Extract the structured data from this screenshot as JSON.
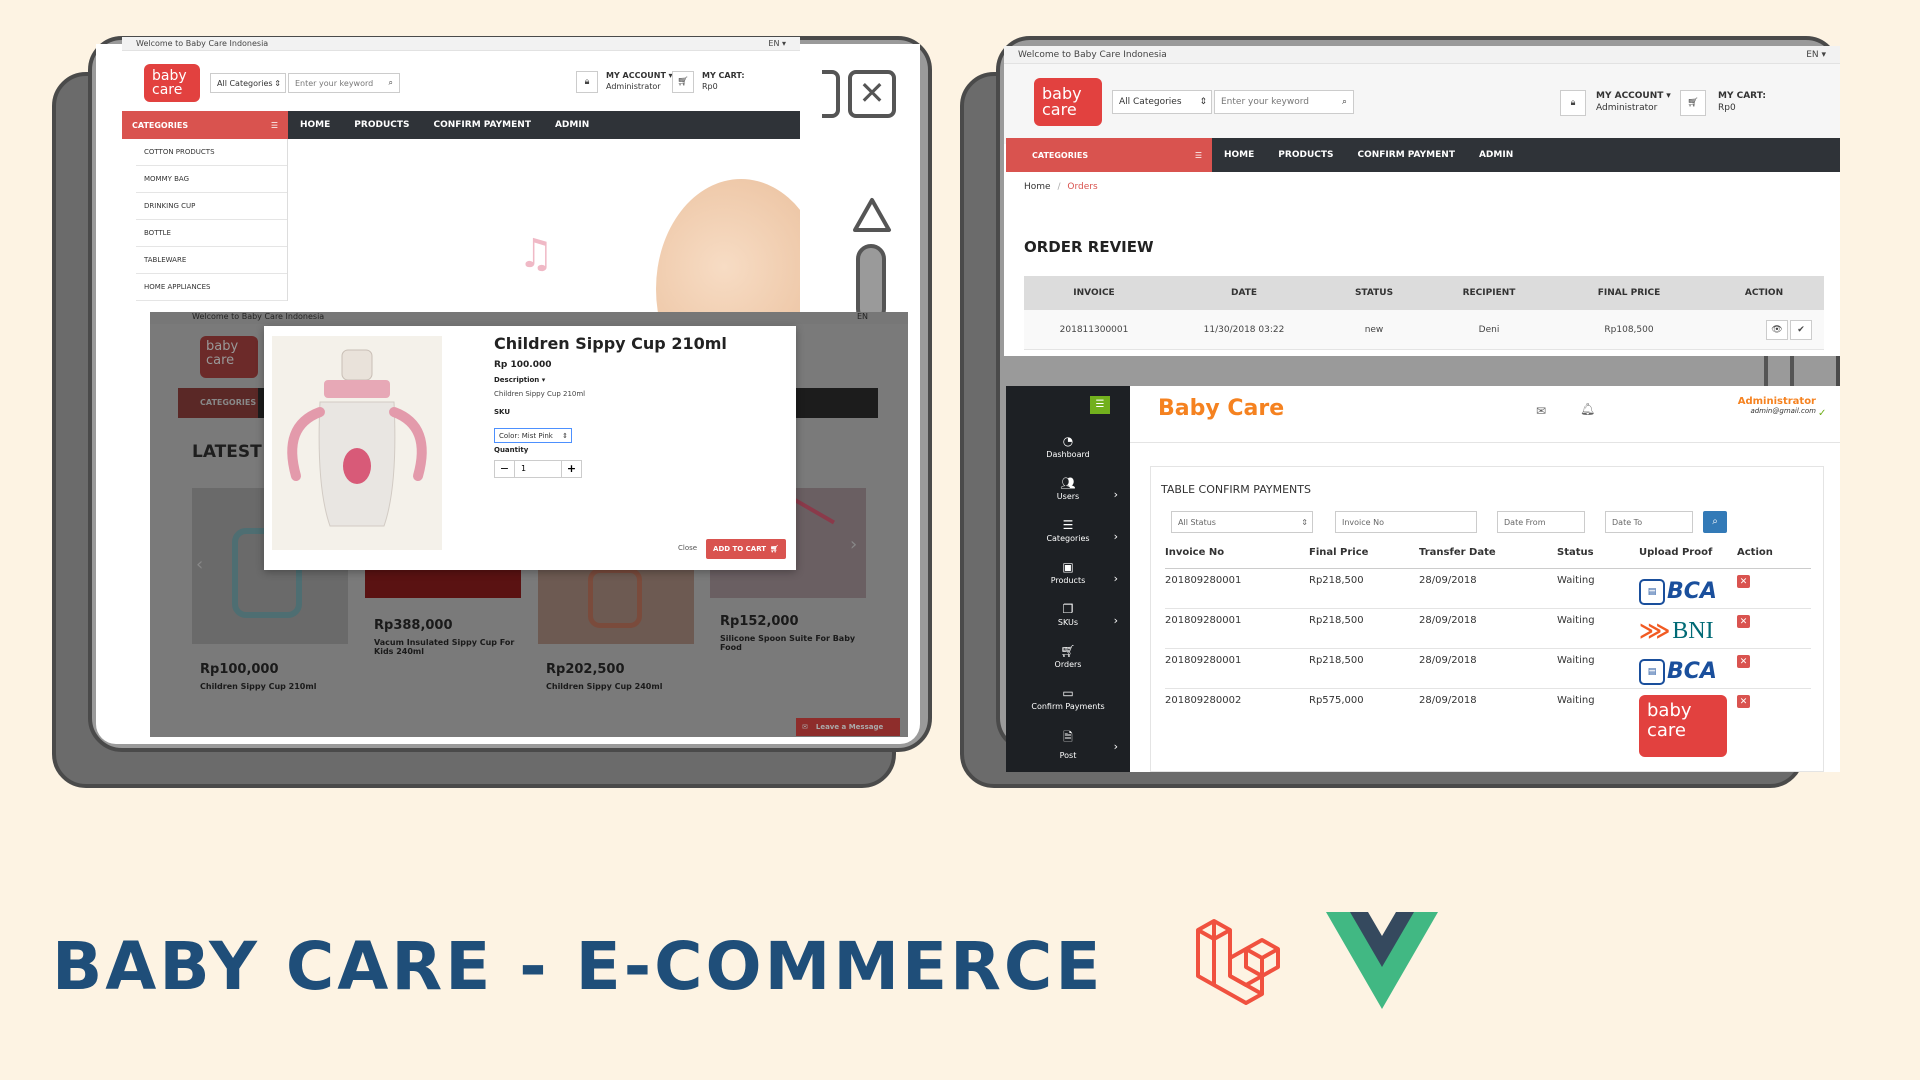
{
  "banner": {
    "title": "BABY CARE - E-COMMERCE"
  },
  "colors": {
    "background": "#fdf3e3",
    "brand_red": "#e2413f",
    "navy": "#1f4e79",
    "admin_orange": "#f58220",
    "sidebar_dark": "#1d2024"
  },
  "icons": [
    "laravel-logo-icon",
    "vue-logo-icon",
    "close-x-icon",
    "scroll-up-icon",
    "mail-icon",
    "bell-icon",
    "cart-icon",
    "lock-icon",
    "search-icon"
  ],
  "shop": {
    "welcome": "Welcome to Baby Care Indonesia",
    "lang": "EN",
    "logo_line1": "baby",
    "logo_line2": "care",
    "category_select": "All Categories",
    "search_placeholder": "Enter your keyword",
    "account_label": "MY ACCOUNT",
    "account_user": "Administrator",
    "cart_label": "MY CART:",
    "cart_value": "Rp0",
    "categories_label": "CATEGORIES",
    "nav": [
      "HOME",
      "PRODUCTS",
      "CONFIRM PAYMENT",
      "ADMIN"
    ],
    "categories": [
      "COTTON PRODUCTS",
      "MOMMY BAG",
      "DRINKING CUP",
      "BOTTLE",
      "TABLEWARE",
      "HOME APPLIANCES"
    ]
  },
  "modal": {
    "title": "Children Sippy Cup 210ml",
    "price": "Rp 100.000",
    "description_label": "Description",
    "description_text": "Children Sippy Cup 210ml",
    "sku_label": "SKU",
    "sku_value": "Color: Mist Pink",
    "quantity_label": "Quantity",
    "quantity_value": "1",
    "minus": "−",
    "plus": "+",
    "close_label": "Close",
    "add_to_cart": "ADD TO CART"
  },
  "latest": {
    "heading": "LATEST P",
    "products": [
      {
        "price": "Rp100,000",
        "name": "Children Sippy Cup 210ml"
      },
      {
        "price": "Rp388,000",
        "name": "Vacum Insulated Sippy Cup For Kids 240ml"
      },
      {
        "price": "Rp202,500",
        "name": "Children Sippy Cup 240ml"
      },
      {
        "price": "Rp152,000",
        "name": "Silicone Spoon Suite For Baby Food"
      }
    ],
    "leave_message": "Leave a Message"
  },
  "orders": {
    "breadcrumb_home": "Home",
    "breadcrumb_current": "Orders",
    "heading": "ORDER REVIEW",
    "columns": [
      "INVOICE",
      "DATE",
      "STATUS",
      "RECIPIENT",
      "FINAL PRICE",
      "ACTION"
    ],
    "rows": [
      {
        "invoice": "201811300001",
        "date": "11/30/2018 03:22",
        "status": "new",
        "recipient": "Deni",
        "final_price": "Rp108,500"
      }
    ]
  },
  "admin": {
    "brand": "Baby Care",
    "user_name": "Administrator",
    "user_email": "admin@gmail.com",
    "sidebar": [
      "Dashboard",
      "Users",
      "Categories",
      "Products",
      "SKUs",
      "Orders",
      "Confirm Payments",
      "Post"
    ],
    "panel_title": "TABLE CONFIRM PAYMENTS",
    "filter_status": "All Status",
    "filter_invoice": "Invoice No",
    "filter_from": "Date From",
    "filter_to": "Date To",
    "columns": [
      "Invoice No",
      "Final Price",
      "Transfer Date",
      "Status",
      "Upload Proof",
      "Action"
    ],
    "rows": [
      {
        "invoice": "201809280001",
        "price": "Rp218,500",
        "date": "28/09/2018",
        "status": "Waiting",
        "proof": "BCA"
      },
      {
        "invoice": "201809280001",
        "price": "Rp218,500",
        "date": "28/09/2018",
        "status": "Waiting",
        "proof": "BNI"
      },
      {
        "invoice": "201809280001",
        "price": "Rp218,500",
        "date": "28/09/2018",
        "status": "Waiting",
        "proof": "BCA"
      },
      {
        "invoice": "201809280002",
        "price": "Rp575,000",
        "date": "28/09/2018",
        "status": "Waiting",
        "proof": "baby care"
      }
    ]
  }
}
